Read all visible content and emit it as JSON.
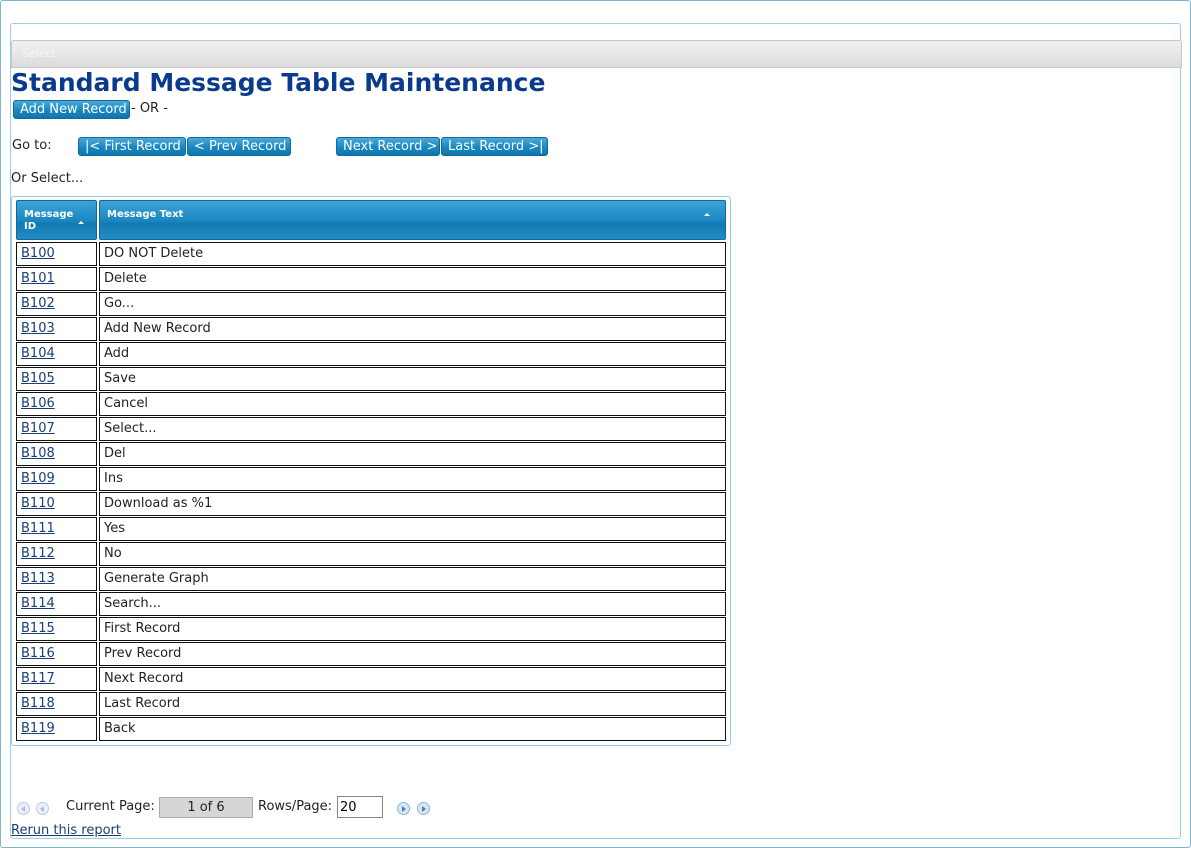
{
  "window": {
    "title_bar_text": "Select"
  },
  "page": {
    "title": "Standard Message Table Maintenance"
  },
  "actions": {
    "add_new_record": "Add New Record",
    "or_text": "- OR -",
    "goto_label": "Go to:",
    "first_record": "|< First Record",
    "prev_record": "< Prev Record",
    "next_record": "Next Record >",
    "last_record": "Last Record >|",
    "or_select": "Or Select..."
  },
  "table": {
    "columns": [
      {
        "label": "Message ID"
      },
      {
        "label": "Message Text"
      }
    ],
    "rows": [
      {
        "id": "B100",
        "text": "DO NOT Delete"
      },
      {
        "id": "B101",
        "text": "Delete"
      },
      {
        "id": "B102",
        "text": "Go..."
      },
      {
        "id": "B103",
        "text": "Add New Record"
      },
      {
        "id": "B104",
        "text": "Add"
      },
      {
        "id": "B105",
        "text": "Save"
      },
      {
        "id": "B106",
        "text": "Cancel"
      },
      {
        "id": "B107",
        "text": "Select..."
      },
      {
        "id": "B108",
        "text": "Del"
      },
      {
        "id": "B109",
        "text": "Ins"
      },
      {
        "id": "B110",
        "text": "Download as %1"
      },
      {
        "id": "B111",
        "text": "Yes"
      },
      {
        "id": "B112",
        "text": "No"
      },
      {
        "id": "B113",
        "text": "Generate Graph"
      },
      {
        "id": "B114",
        "text": "Search..."
      },
      {
        "id": "B115",
        "text": "First Record"
      },
      {
        "id": "B116",
        "text": "Prev Record"
      },
      {
        "id": "B117",
        "text": "Next Record"
      },
      {
        "id": "B118",
        "text": "Last Record"
      },
      {
        "id": "B119",
        "text": "Back"
      }
    ]
  },
  "pager": {
    "current_page_label": "Current Page:",
    "current_page_value": "1 of 6",
    "rows_per_page_label": "Rows/Page:",
    "rows_per_page_value": "20"
  },
  "footer": {
    "rerun_link": "Rerun this report"
  },
  "colors": {
    "title": "#0a3a8c",
    "button": "#1a87c2",
    "link": "#1a3f73",
    "frame_border": "#9ccfe3"
  }
}
